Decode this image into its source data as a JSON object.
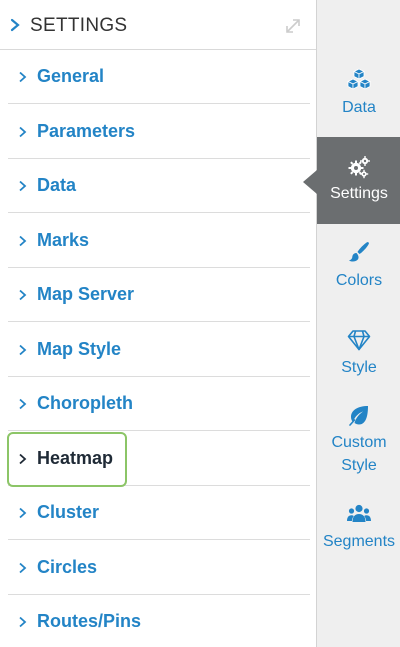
{
  "header": {
    "title": "SETTINGS",
    "expand_icon": "expand-icon"
  },
  "sections": [
    {
      "label": "General"
    },
    {
      "label": "Parameters"
    },
    {
      "label": "Data"
    },
    {
      "label": "Marks"
    },
    {
      "label": "Map Server"
    },
    {
      "label": "Map Style"
    },
    {
      "label": "Choropleth"
    },
    {
      "label": "Heatmap",
      "active": true
    },
    {
      "label": "Cluster"
    },
    {
      "label": "Circles"
    },
    {
      "label": "Routes/Pins"
    }
  ],
  "rail": {
    "items": [
      {
        "label": "Data",
        "icon": "cubes-icon"
      },
      {
        "label": "Settings",
        "icon": "gears-icon",
        "active": true
      },
      {
        "label": "Colors",
        "icon": "brush-icon"
      },
      {
        "label": "Style",
        "icon": "diamond-icon"
      },
      {
        "label_line1": "Custom",
        "label_line2": "Style",
        "icon": "leaf-icon"
      },
      {
        "label": "Segments",
        "icon": "users-icon"
      }
    ]
  },
  "colors": {
    "link": "#2384c6",
    "active_text": "#1f2a36",
    "highlight": "#8cc567",
    "rail_bg": "#efefef",
    "rail_active": "#6b6e70"
  }
}
